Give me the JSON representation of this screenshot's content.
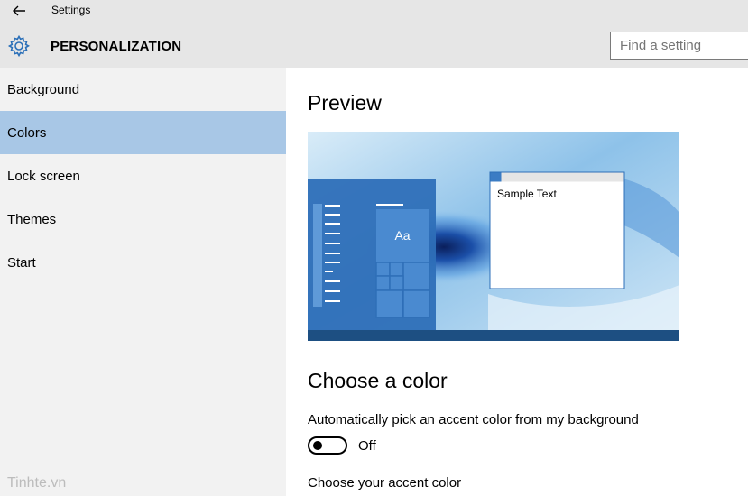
{
  "window": {
    "title": "Settings"
  },
  "header": {
    "section": "PERSONALIZATION",
    "search_placeholder": "Find a setting"
  },
  "sidebar": {
    "items": [
      {
        "label": "Background"
      },
      {
        "label": "Colors"
      },
      {
        "label": "Lock screen"
      },
      {
        "label": "Themes"
      },
      {
        "label": "Start"
      }
    ]
  },
  "main": {
    "preview_heading": "Preview",
    "preview": {
      "sample_text": "Sample Text",
      "tile_text": "Aa"
    },
    "choose_heading": "Choose a color",
    "auto_label": "Automatically pick an accent color from my background",
    "auto_state": "Off",
    "accent_label": "Choose your accent color"
  },
  "watermark": "Tinhte.vn",
  "colors": {
    "selected_nav": "#a8c7e6",
    "accent": "#3b7cc4",
    "chrome": "#e6e6e6"
  }
}
